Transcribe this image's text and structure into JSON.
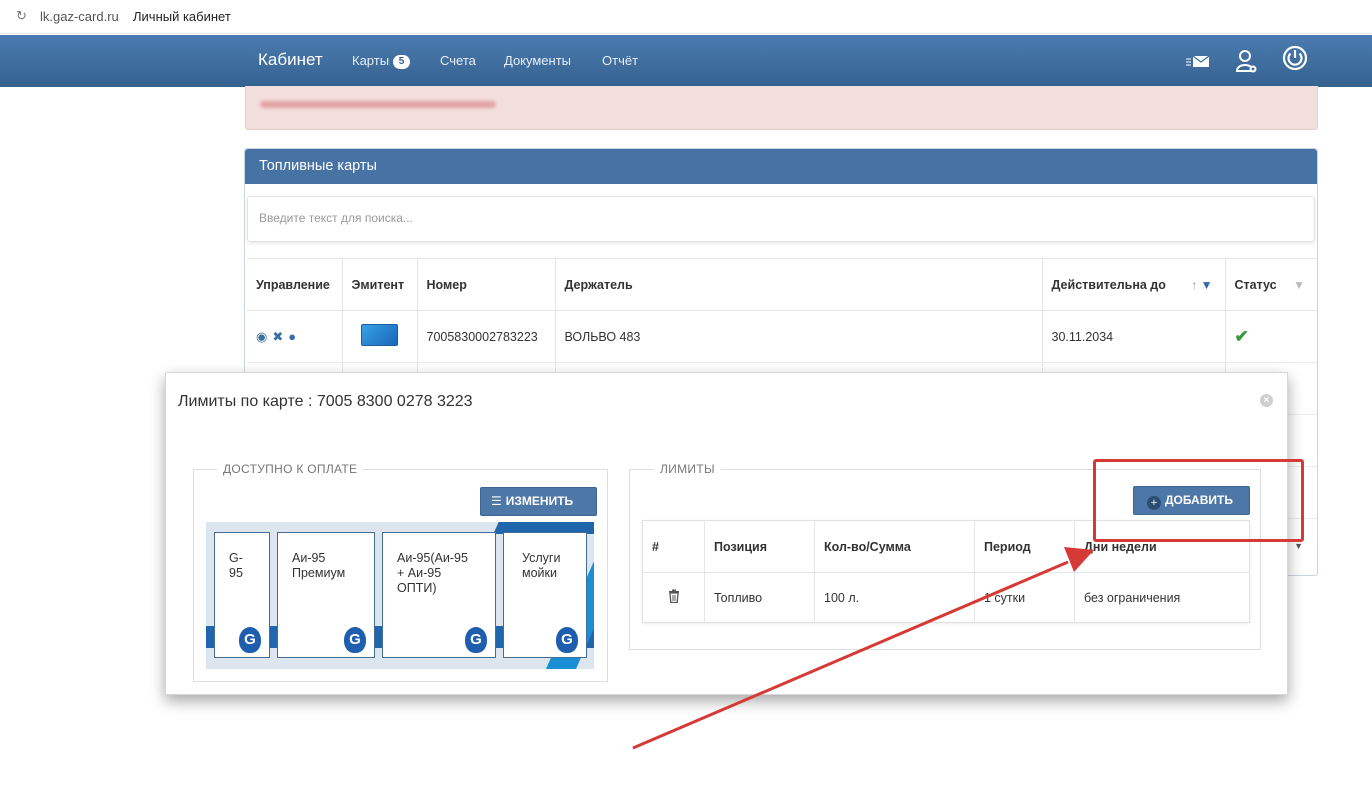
{
  "browser": {
    "url": "lk.gaz-card.ru",
    "title": "Личный кабинет"
  },
  "nav": {
    "brand": "Кабинет",
    "items": [
      {
        "label": "Карты",
        "badge": "5"
      },
      {
        "label": "Счета"
      },
      {
        "label": "Документы"
      },
      {
        "label": "Отчёт"
      }
    ],
    "icons": [
      "mail-icon",
      "user-settings-icon",
      "power-icon"
    ]
  },
  "panel": {
    "title": "Топливные карты",
    "search_placeholder": "Введите текст для поиска...",
    "columns": [
      "Управление",
      "Эмитент",
      "Номер",
      "Держатель",
      "Действительна до",
      "Статус"
    ],
    "rows": [
      {
        "number": "7005830002783223",
        "holder": "ВОЛЬВО 483",
        "valid_until": "30.11.2034",
        "status": "active"
      }
    ]
  },
  "modal": {
    "title": "Лимиты по карте : 7005 8300 0278 3223",
    "available": {
      "legend": "ДОСТУПНО К ОПЛАТЕ",
      "edit_button": "ИЗМЕНИТЬ",
      "fuels": [
        {
          "label": "G-\n95"
        },
        {
          "label": "Аи-95\nПремиум"
        },
        {
          "label": "Аи-95(Аи-95\n+ Аи-95\nОПТИ)"
        },
        {
          "label": "Услуги\nмойки"
        }
      ]
    },
    "limits": {
      "legend": "ЛИМИТЫ",
      "add_button": "ДОБАВИТЬ",
      "columns": [
        "#",
        "Позиция",
        "Кол-во/Сумма",
        "Период",
        "Дни недели"
      ],
      "rows": [
        {
          "position": "Топливо",
          "amount": "100 л.",
          "period": "1 сутки",
          "days": "без ограничения"
        }
      ]
    }
  },
  "colors": {
    "navbar": "#3c6a99",
    "panel_header": "#4673a3",
    "button": "#4d77a7",
    "annotation": "#d63a36"
  }
}
